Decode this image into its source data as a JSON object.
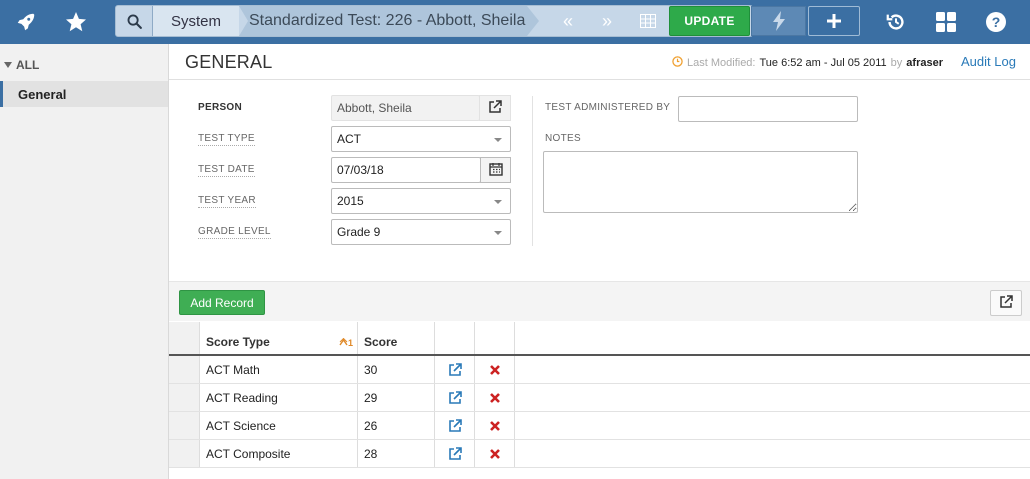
{
  "topbar": {
    "system_label": "System",
    "record_title": "Standardized Test: 226 - Abbott, Sheila",
    "prev_symbol": "«",
    "next_symbol": "»",
    "update_label": "UPDATE",
    "icons": [
      "rocket-icon",
      "star-icon",
      "search-icon",
      "grid-icon",
      "bolt-icon",
      "plus-icon",
      "history-icon",
      "apps-icon",
      "help-icon"
    ]
  },
  "sidebar": {
    "all_label": "ALL",
    "items": [
      {
        "label": "General",
        "selected": true
      }
    ]
  },
  "header": {
    "title": "GENERAL",
    "last_modified_label": "Last Modified:",
    "last_modified_value": "Tue 6:52 am - Jul 05 2011",
    "by_label": "by",
    "by_user": "afraser",
    "audit_log_label": "Audit Log"
  },
  "form": {
    "person": {
      "label": "PERSON",
      "value": "Abbott, Sheila"
    },
    "test_type": {
      "label": "TEST TYPE",
      "value": "ACT"
    },
    "test_date": {
      "label": "TEST DATE",
      "value": "07/03/18"
    },
    "test_year": {
      "label": "TEST YEAR",
      "value": "2015"
    },
    "grade_level": {
      "label": "GRADE LEVEL",
      "value": "Grade 9"
    },
    "administered_by": {
      "label": "TEST ADMINISTERED BY",
      "value": ""
    },
    "notes": {
      "label": "NOTES",
      "value": ""
    }
  },
  "scores": {
    "add_label": "Add Record",
    "columns": {
      "score_type": "Score Type",
      "score": "Score",
      "sort_rank": "1"
    },
    "rows": [
      {
        "score_type": "ACT Math",
        "score": "30"
      },
      {
        "score_type": "ACT Reading",
        "score": "29"
      },
      {
        "score_type": "ACT Science",
        "score": "26"
      },
      {
        "score_type": "ACT Composite",
        "score": "28"
      }
    ]
  },
  "colors": {
    "topbar": "#3b6fa3",
    "update_green": "#2eaa4a",
    "link_blue": "#2a7ab8",
    "delete_red": "#cc2222"
  }
}
